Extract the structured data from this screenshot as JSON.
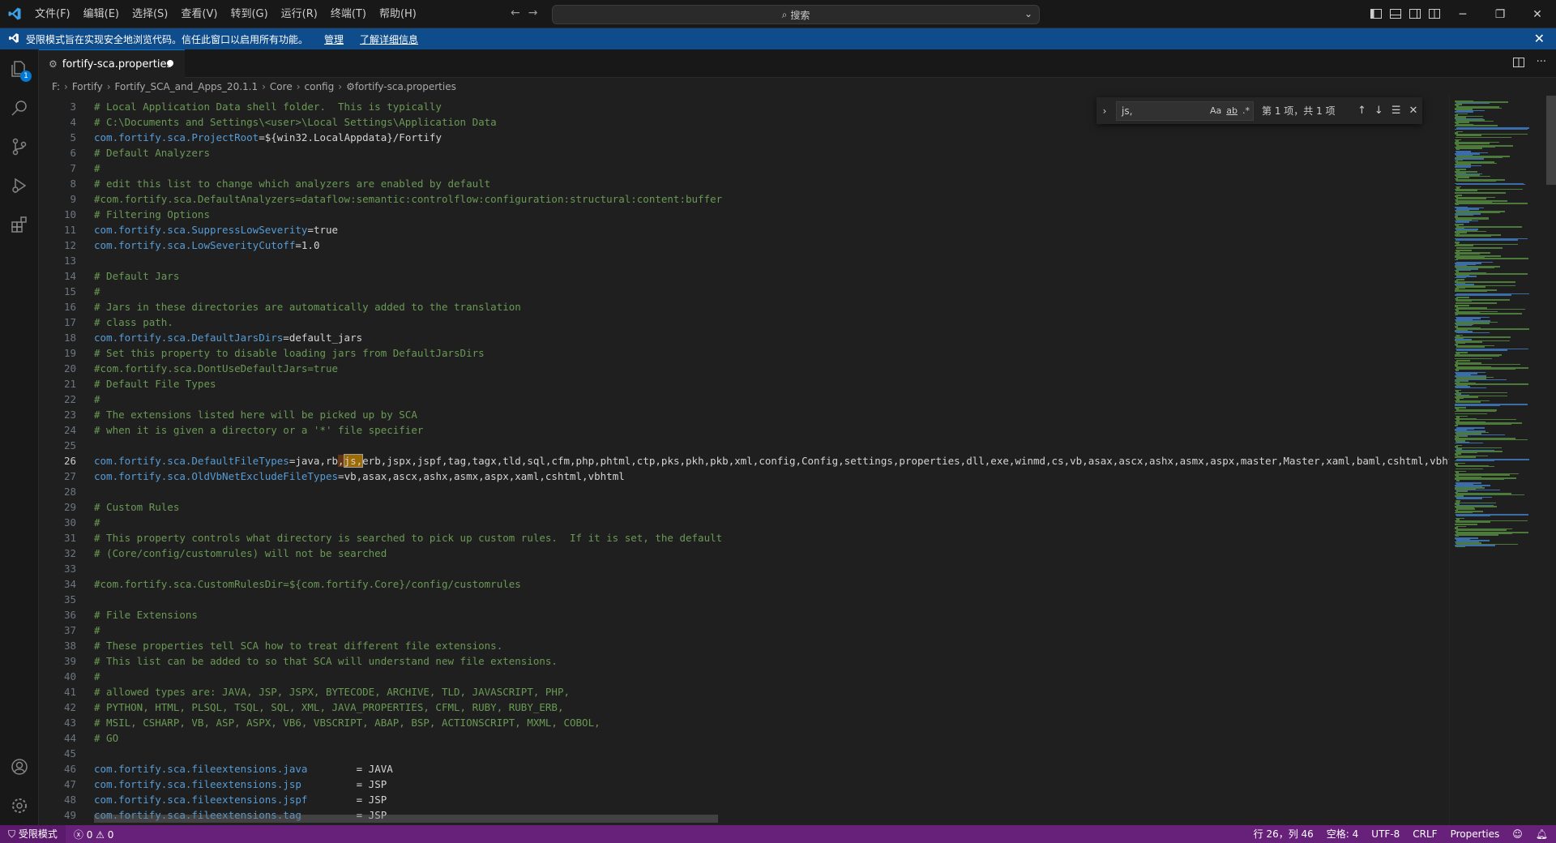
{
  "titlebar": {
    "menu": [
      "文件(F)",
      "编辑(E)",
      "选择(S)",
      "查看(V)",
      "转到(G)",
      "运行(R)",
      "终端(T)",
      "帮助(H)"
    ],
    "search_placeholder": "搜索"
  },
  "banner": {
    "message": "受限模式旨在实现安全地浏览代码。信任此窗口以启用所有功能。",
    "manage_link": "管理",
    "learn_more_link": "了解详细信息"
  },
  "activity": {
    "explorer_badge": "1"
  },
  "tab": {
    "label": "fortify-sca.properties"
  },
  "breadcrumbs": [
    "F:",
    "Fortify",
    "Fortify_SCA_and_Apps_20.1.1",
    "Core",
    "config",
    "fortify-sca.properties"
  ],
  "find": {
    "query": "js,",
    "case_label": "Aa",
    "word_label": "ab",
    "regex_label": ".*",
    "result": "第 1 项，共 1 项"
  },
  "editor": {
    "active_line": 26,
    "lines": [
      {
        "n": 3,
        "type": "comment",
        "text": "# Local Application Data shell folder.  This is typically"
      },
      {
        "n": 4,
        "type": "comment",
        "text": "# C:\\Documents and Settings\\<user>\\Local Settings\\Application Data"
      },
      {
        "n": 5,
        "type": "kv",
        "key": "com.fortify.sca.ProjectRoot",
        "value": "${win32.LocalAppdata}/Fortify"
      },
      {
        "n": 6,
        "type": "comment",
        "text": "# Default Analyzers"
      },
      {
        "n": 7,
        "type": "comment",
        "text": "#"
      },
      {
        "n": 8,
        "type": "comment",
        "text": "# edit this list to change which analyzers are enabled by default"
      },
      {
        "n": 9,
        "type": "comment",
        "text": "#com.fortify.sca.DefaultAnalyzers=dataflow:semantic:controlflow:configuration:structural:content:buffer"
      },
      {
        "n": 10,
        "type": "comment",
        "text": "# Filtering Options"
      },
      {
        "n": 11,
        "type": "kv",
        "key": "com.fortify.sca.SuppressLowSeverity",
        "value": "true"
      },
      {
        "n": 12,
        "type": "kv",
        "key": "com.fortify.sca.LowSeverityCutoff",
        "value": "1.0"
      },
      {
        "n": 13,
        "type": "blank",
        "text": ""
      },
      {
        "n": 14,
        "type": "comment",
        "text": "# Default Jars"
      },
      {
        "n": 15,
        "type": "comment",
        "text": "#"
      },
      {
        "n": 16,
        "type": "comment",
        "text": "# Jars in these directories are automatically added to the translation"
      },
      {
        "n": 17,
        "type": "comment",
        "text": "# class path."
      },
      {
        "n": 18,
        "type": "kv",
        "key": "com.fortify.sca.DefaultJarsDirs",
        "value": "default_jars"
      },
      {
        "n": 19,
        "type": "comment",
        "text": "# Set this property to disable loading jars from DefaultJarsDirs"
      },
      {
        "n": 20,
        "type": "comment",
        "text": "#com.fortify.sca.DontUseDefaultJars=true"
      },
      {
        "n": 21,
        "type": "comment",
        "text": "# Default File Types"
      },
      {
        "n": 22,
        "type": "comment",
        "text": "#"
      },
      {
        "n": 23,
        "type": "comment",
        "text": "# The extensions listed here will be picked up by SCA"
      },
      {
        "n": 24,
        "type": "comment",
        "text": "# when it is given a directory or a '*' file specifier"
      },
      {
        "n": 25,
        "type": "blank",
        "text": ""
      },
      {
        "n": 26,
        "type": "kvhl",
        "key": "com.fortify.sca.DefaultFileTypes",
        "pre": "java,rb",
        "match_a": ",",
        "match_b": "js,",
        "post": "erb,jspx,jspf,tag,tagx,tld,sql,cfm,php,phtml,ctp,pks,pkh,pkb,xml,config,Config,settings,properties,dll,exe,winmd,cs,vb,asax,ascx,ashx,asmx,aspx,master,Master,xaml,baml,cshtml,vbhtml"
      },
      {
        "n": 27,
        "type": "kv",
        "key": "com.fortify.sca.OldVbNetExcludeFileTypes",
        "value": "vb,asax,ascx,ashx,asmx,aspx,xaml,cshtml,vbhtml"
      },
      {
        "n": 28,
        "type": "blank",
        "text": ""
      },
      {
        "n": 29,
        "type": "comment",
        "text": "# Custom Rules"
      },
      {
        "n": 30,
        "type": "comment",
        "text": "#"
      },
      {
        "n": 31,
        "type": "comment",
        "text": "# This property controls what directory is searched to pick up custom rules.  If it is set, the default"
      },
      {
        "n": 32,
        "type": "comment",
        "text": "# (Core/config/customrules) will not be searched"
      },
      {
        "n": 33,
        "type": "blank",
        "text": ""
      },
      {
        "n": 34,
        "type": "comment",
        "text": "#com.fortify.sca.CustomRulesDir=${com.fortify.Core}/config/customrules"
      },
      {
        "n": 35,
        "type": "blank",
        "text": ""
      },
      {
        "n": 36,
        "type": "comment",
        "text": "# File Extensions"
      },
      {
        "n": 37,
        "type": "comment",
        "text": "#"
      },
      {
        "n": 38,
        "type": "comment",
        "text": "# These properties tell SCA how to treat different file extensions."
      },
      {
        "n": 39,
        "type": "comment",
        "text": "# This list can be added to so that SCA will understand new file extensions."
      },
      {
        "n": 40,
        "type": "comment",
        "text": "#"
      },
      {
        "n": 41,
        "type": "comment",
        "text": "# allowed types are: JAVA, JSP, JSPX, BYTECODE, ARCHIVE, TLD, JAVASCRIPT, PHP,"
      },
      {
        "n": 42,
        "type": "comment",
        "text": "# PYTHON, HTML, PLSQL, TSQL, SQL, XML, JAVA_PROPERTIES, CFML, RUBY, RUBY_ERB,"
      },
      {
        "n": 43,
        "type": "comment",
        "text": "# MSIL, CSHARP, VB, ASP, ASPX, VB6, VBSCRIPT, ABAP, BSP, ACTIONSCRIPT, MXML, COBOL,"
      },
      {
        "n": 44,
        "type": "comment",
        "text": "# GO"
      },
      {
        "n": 45,
        "type": "blank",
        "text": ""
      },
      {
        "n": 46,
        "type": "kvs",
        "key": "com.fortify.sca.fileextensions.java",
        "pad": "       ",
        "value": "JAVA"
      },
      {
        "n": 47,
        "type": "kvs",
        "key": "com.fortify.sca.fileextensions.jsp",
        "pad": "        ",
        "value": "JSP"
      },
      {
        "n": 48,
        "type": "kvs",
        "key": "com.fortify.sca.fileextensions.jspf",
        "pad": "       ",
        "value": "JSP"
      },
      {
        "n": 49,
        "type": "kvs",
        "key": "com.fortify.sca.fileextensions.tag",
        "pad": "        ",
        "value": "JSP"
      }
    ]
  },
  "status": {
    "restricted": "受限模式",
    "errors": "0",
    "warnings": "0",
    "cursor": "行 26，列 46",
    "spaces": "空格: 4",
    "encoding": "UTF-8",
    "eol": "CRLF",
    "language": "Properties"
  },
  "colors": {
    "accent": "#0078d4",
    "status_bar": "#68217a",
    "banner": "#0e4c8c",
    "comment": "#6a9955",
    "key": "#569cd6"
  }
}
